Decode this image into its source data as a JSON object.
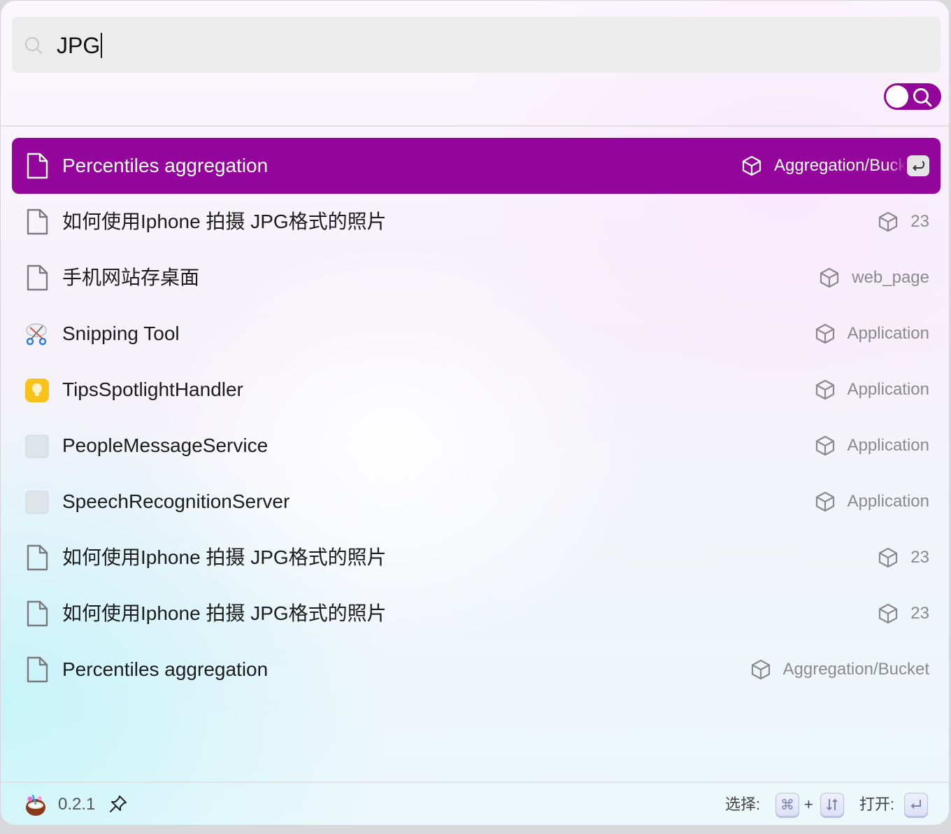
{
  "search": {
    "value": "JPG"
  },
  "results": [
    {
      "icon": "document-icon",
      "title": "Percentiles aggregation",
      "tag": "Aggregation/Bucket",
      "active": true
    },
    {
      "icon": "document-icon",
      "title": "如何使用Iphone 拍摄 JPG格式的照片",
      "tag": "23"
    },
    {
      "icon": "document-icon",
      "title": "手机网站存桌面",
      "tag": "web_page"
    },
    {
      "icon": "snipping-tool-icon",
      "title": "Snipping Tool",
      "tag": "Application"
    },
    {
      "icon": "lightbulb-app-icon",
      "title": "TipsSpotlightHandler",
      "tag": "Application"
    },
    {
      "icon": "generic-app-icon",
      "title": "PeopleMessageService",
      "tag": "Application"
    },
    {
      "icon": "generic-app-icon",
      "title": "SpeechRecognitionServer",
      "tag": "Application"
    },
    {
      "icon": "document-icon",
      "title": "如何使用Iphone 拍摄 JPG格式的照片",
      "tag": "23"
    },
    {
      "icon": "document-icon",
      "title": "如何使用Iphone 拍摄 JPG格式的照片",
      "tag": "23"
    },
    {
      "icon": "document-icon",
      "title": "Percentiles aggregation",
      "tag": "Aggregation/Bucket"
    }
  ],
  "footer": {
    "version": "0.2.1",
    "select_label": "选择:",
    "plus": "+",
    "open_label": "打开:"
  },
  "colors": {
    "accent": "#94069b",
    "search_bg": "#ececed"
  }
}
